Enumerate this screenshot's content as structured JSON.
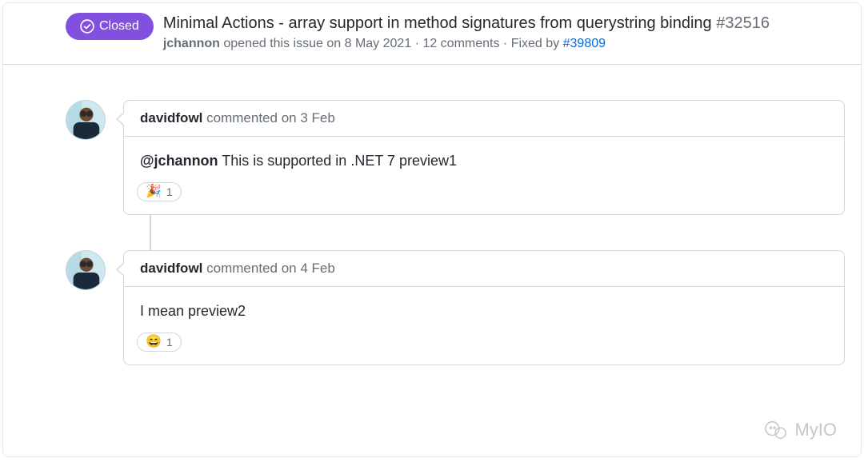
{
  "status": {
    "label": "Closed"
  },
  "issue": {
    "title": "Minimal Actions - array support in method signatures from querystring binding",
    "number": "#32516",
    "author": "jchannon",
    "opened_verb": "opened this issue",
    "opened_date": "on 8 May 2021",
    "comment_count_text": "12 comments",
    "fixed_by_prefix": "Fixed by",
    "fixed_by_pr": "#39809"
  },
  "comments": [
    {
      "author": "davidfowl",
      "verb": "commented",
      "date": "on 3 Feb",
      "mention": "@jchannon",
      "body_rest": " This is supported in .NET 7 preview1",
      "reaction_emoji": "🎉",
      "reaction_count": "1"
    },
    {
      "author": "davidfowl",
      "verb": "commented",
      "date": "on 4 Feb",
      "mention": "",
      "body_rest": "I mean preview2",
      "reaction_emoji": "😄",
      "reaction_count": "1"
    }
  ],
  "watermark": {
    "text": "MyIO"
  }
}
